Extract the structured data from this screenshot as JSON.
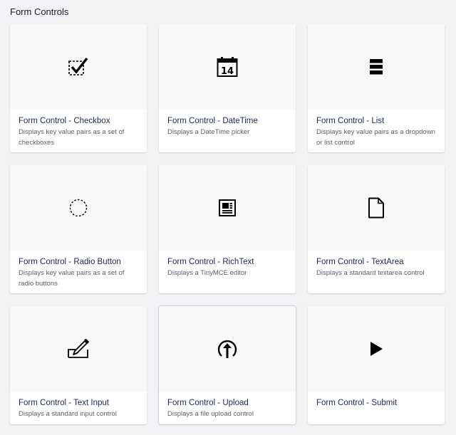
{
  "section": {
    "title": "Form Controls"
  },
  "cards": [
    {
      "title": "Form Control - Checkbox",
      "description": "Displays key value pairs as a set of checkboxes",
      "icon": "checkbox-icon"
    },
    {
      "title": "Form Control - DateTime",
      "description": "Displays a DateTime picker",
      "icon": "calendar-icon",
      "icon_text": "14"
    },
    {
      "title": "Form Control - List",
      "description": "Displays key value pairs as a dropdown or list control",
      "icon": "list-icon"
    },
    {
      "title": "Form Control - Radio Button",
      "description": "Displays key value pairs as a set of radio buttons",
      "icon": "radio-button-icon"
    },
    {
      "title": "Form Control - RichText",
      "description": "Displays a TinyMCE editor",
      "icon": "richtext-document-icon"
    },
    {
      "title": "Form Control - TextArea",
      "description": "Displays a standard textarea control",
      "icon": "document-icon"
    },
    {
      "title": "Form Control - Text Input",
      "description": "Displays a standard input control",
      "icon": "pencil-input-icon"
    },
    {
      "title": "Form Control - Upload",
      "description": "Displays a file upload control",
      "icon": "upload-icon"
    },
    {
      "title": "Form Control - Submit",
      "description": "",
      "icon": "play-icon"
    }
  ]
}
